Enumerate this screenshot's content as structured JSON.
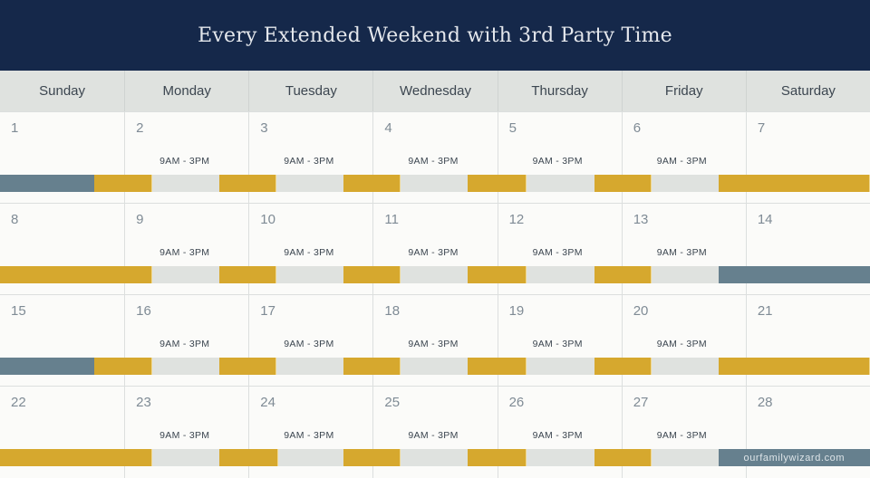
{
  "title": "Every Extended Weekend with 3rd Party Time",
  "days_of_week": [
    "Sunday",
    "Monday",
    "Tuesday",
    "Wednesday",
    "Thursday",
    "Friday",
    "Saturday"
  ],
  "colors": {
    "header_bg": "#15284a",
    "parent_a_yellow": "#d6a82e",
    "parent_b_slate": "#66808e",
    "third_party_light": "#dfe2df"
  },
  "weeks": [
    {
      "days": [
        {
          "num": "1",
          "time": ""
        },
        {
          "num": "2",
          "time": "9AM - 3PM"
        },
        {
          "num": "3",
          "time": "9AM - 3PM"
        },
        {
          "num": "4",
          "time": "9AM - 3PM"
        },
        {
          "num": "5",
          "time": "9AM - 3PM"
        },
        {
          "num": "6",
          "time": "9AM - 3PM"
        },
        {
          "num": "7",
          "time": ""
        }
      ],
      "segments": [
        {
          "type": "slate",
          "start": 0,
          "end": 0.76
        },
        {
          "type": "yellow",
          "start": 0.76,
          "end": 1.225
        },
        {
          "type": "light",
          "start": 1.225,
          "end": 1.765
        },
        {
          "type": "yellow",
          "start": 1.765,
          "end": 2.225
        },
        {
          "type": "light",
          "start": 2.225,
          "end": 2.765
        },
        {
          "type": "yellow",
          "start": 2.765,
          "end": 3.225
        },
        {
          "type": "light",
          "start": 3.225,
          "end": 3.765
        },
        {
          "type": "yellow",
          "start": 3.765,
          "end": 4.235
        },
        {
          "type": "light",
          "start": 4.235,
          "end": 4.78
        },
        {
          "type": "yellow",
          "start": 4.78,
          "end": 5.24
        },
        {
          "type": "light",
          "start": 5.24,
          "end": 5.78
        },
        {
          "type": "yellow",
          "start": 5.78,
          "end": 7
        }
      ]
    },
    {
      "days": [
        {
          "num": "8",
          "time": ""
        },
        {
          "num": "9",
          "time": "9AM - 3PM"
        },
        {
          "num": "10",
          "time": "9AM - 3PM"
        },
        {
          "num": "11",
          "time": "9AM - 3PM"
        },
        {
          "num": "12",
          "time": "9AM - 3PM"
        },
        {
          "num": "13",
          "time": "9AM - 3PM"
        },
        {
          "num": "14",
          "time": ""
        }
      ],
      "segments": [
        {
          "type": "yellow",
          "start": 0,
          "end": 1.225
        },
        {
          "type": "light",
          "start": 1.225,
          "end": 1.765
        },
        {
          "type": "yellow",
          "start": 1.765,
          "end": 2.225
        },
        {
          "type": "light",
          "start": 2.225,
          "end": 2.765
        },
        {
          "type": "yellow",
          "start": 2.765,
          "end": 3.225
        },
        {
          "type": "light",
          "start": 3.225,
          "end": 3.765
        },
        {
          "type": "yellow",
          "start": 3.765,
          "end": 4.235
        },
        {
          "type": "light",
          "start": 4.235,
          "end": 4.78
        },
        {
          "type": "yellow",
          "start": 4.78,
          "end": 5.24
        },
        {
          "type": "light",
          "start": 5.24,
          "end": 5.78
        },
        {
          "type": "slate",
          "start": 5.78,
          "end": 7
        }
      ]
    },
    {
      "days": [
        {
          "num": "15",
          "time": ""
        },
        {
          "num": "16",
          "time": "9AM - 3PM"
        },
        {
          "num": "17",
          "time": "9AM - 3PM"
        },
        {
          "num": "18",
          "time": "9AM - 3PM"
        },
        {
          "num": "19",
          "time": "9AM - 3PM"
        },
        {
          "num": "20",
          "time": "9AM - 3PM"
        },
        {
          "num": "21",
          "time": ""
        }
      ],
      "segments": [
        {
          "type": "slate",
          "start": 0,
          "end": 0.76
        },
        {
          "type": "yellow",
          "start": 0.76,
          "end": 1.225
        },
        {
          "type": "light",
          "start": 1.225,
          "end": 1.765
        },
        {
          "type": "yellow",
          "start": 1.765,
          "end": 2.225
        },
        {
          "type": "light",
          "start": 2.225,
          "end": 2.765
        },
        {
          "type": "yellow",
          "start": 2.765,
          "end": 3.225
        },
        {
          "type": "light",
          "start": 3.225,
          "end": 3.765
        },
        {
          "type": "yellow",
          "start": 3.765,
          "end": 4.235
        },
        {
          "type": "light",
          "start": 4.235,
          "end": 4.78
        },
        {
          "type": "yellow",
          "start": 4.78,
          "end": 5.24
        },
        {
          "type": "light",
          "start": 5.24,
          "end": 5.78
        },
        {
          "type": "yellow",
          "start": 5.78,
          "end": 7
        }
      ]
    },
    {
      "days": [
        {
          "num": "22",
          "time": ""
        },
        {
          "num": "23",
          "time": "9AM - 3PM"
        },
        {
          "num": "24",
          "time": "9AM - 3PM"
        },
        {
          "num": "25",
          "time": "9AM - 3PM"
        },
        {
          "num": "26",
          "time": "9AM - 3PM"
        },
        {
          "num": "27",
          "time": "9AM - 3PM"
        },
        {
          "num": "28",
          "time": ""
        }
      ],
      "segments": [
        {
          "type": "yellow",
          "start": 0,
          "end": 1.225
        },
        {
          "type": "light",
          "start": 1.225,
          "end": 1.765
        },
        {
          "type": "yellow",
          "start": 1.765,
          "end": 2.235
        },
        {
          "type": "light",
          "start": 2.235,
          "end": 2.765
        },
        {
          "type": "yellow",
          "start": 2.765,
          "end": 3.225
        },
        {
          "type": "light",
          "start": 3.225,
          "end": 3.765
        },
        {
          "type": "yellow",
          "start": 3.765,
          "end": 4.235
        },
        {
          "type": "light",
          "start": 4.235,
          "end": 4.78
        },
        {
          "type": "yellow",
          "start": 4.78,
          "end": 5.24
        },
        {
          "type": "light",
          "start": 5.24,
          "end": 5.78
        },
        {
          "type": "slate",
          "start": 5.78,
          "end": 7
        }
      ]
    }
  ],
  "brand": {
    "text": "ourfamilywizard.com",
    "week_index": 3,
    "start": 5.78,
    "end": 7
  }
}
